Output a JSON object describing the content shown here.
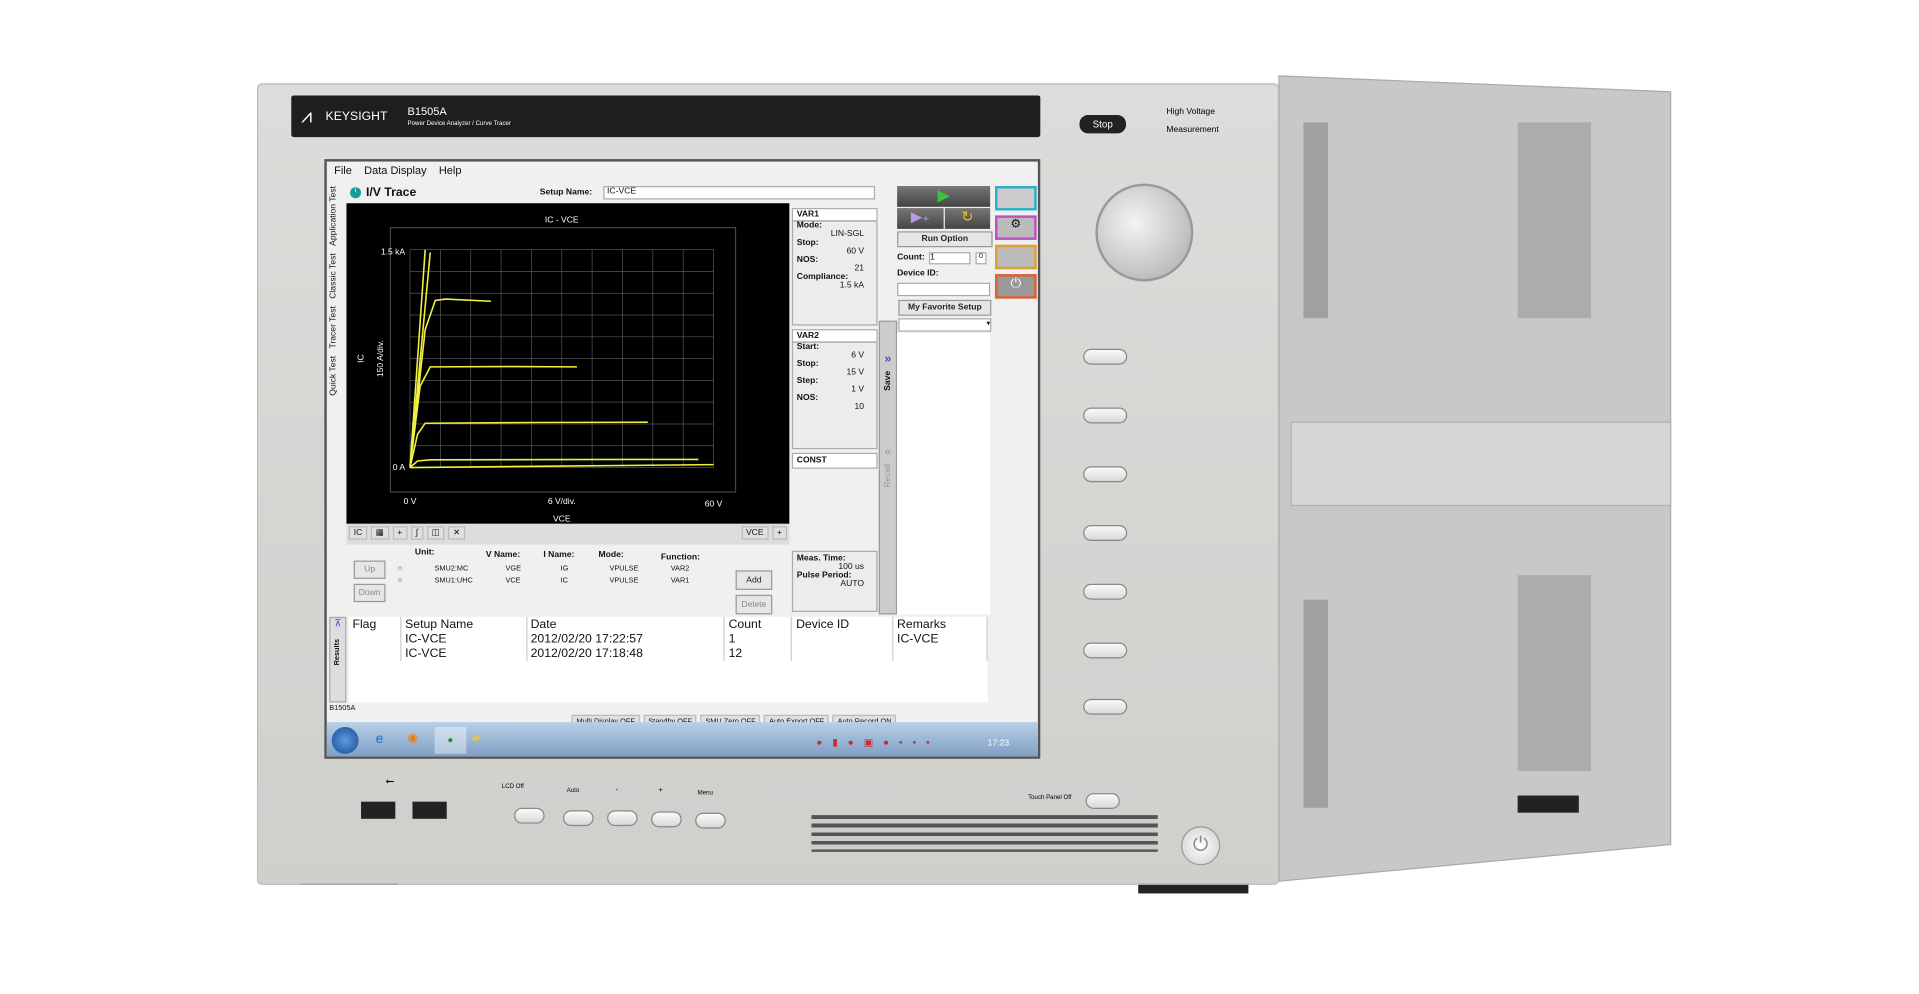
{
  "instrument": {
    "brand": "KEYSIGHT",
    "model": "B1505A",
    "subtitle": "Power Device Analyzer / Curve Tracer",
    "stop_label": "Stop",
    "indicators": [
      "High Voltage",
      "Measurement"
    ],
    "front_buttons": [
      "LCD Off",
      "Auto",
      "-",
      "+",
      "Menu"
    ],
    "touch_panel_label": "Touch Panel Off"
  },
  "menu": [
    "File",
    "Data Display",
    "Help"
  ],
  "side_tabs": [
    "Application Test",
    "Classic Test",
    "Tracer Test",
    "Quick Test"
  ],
  "title": "I/V Trace",
  "setup_name_label": "Setup Name:",
  "setup_name_value": "IC-VCE",
  "plot": {
    "title": "IC - VCE",
    "ylabel": "IC",
    "ydiv": "150 A/div.",
    "ytop": "1.5 kA",
    "ybottom": "0 A",
    "xleft": "0 V",
    "xdiv": "6 V/div.",
    "xright": "60 V",
    "xlabel": "VCE",
    "y_select": "IC",
    "x_select": "VCE"
  },
  "chart_data": {
    "type": "line",
    "title": "IC - VCE",
    "xlabel": "VCE",
    "ylabel": "IC",
    "xlim": [
      0,
      60
    ],
    "ylim": [
      0,
      1500
    ],
    "x_unit": "V",
    "y_unit": "A",
    "grid": true,
    "trace_color": "#f0f040",
    "series": [
      {
        "points": [
          [
            0,
            0
          ],
          [
            30,
            10
          ],
          [
            60,
            20
          ]
        ]
      },
      {
        "points": [
          [
            0,
            0
          ],
          [
            1.5,
            45
          ],
          [
            4,
            53
          ],
          [
            30,
            55
          ],
          [
            57,
            56
          ]
        ]
      },
      {
        "points": [
          [
            0,
            0
          ],
          [
            1.5,
            230
          ],
          [
            3,
            305
          ],
          [
            25,
            310
          ],
          [
            47,
            312
          ]
        ]
      },
      {
        "points": [
          [
            0,
            0
          ],
          [
            2,
            560
          ],
          [
            4,
            693
          ],
          [
            20,
            695
          ],
          [
            33,
            693
          ]
        ]
      },
      {
        "points": [
          [
            0,
            0
          ],
          [
            3,
            950
          ],
          [
            5,
            1150
          ],
          [
            7,
            1160
          ],
          [
            16,
            1145
          ]
        ]
      },
      {
        "points": [
          [
            0,
            0
          ],
          [
            3,
            1500
          ]
        ]
      },
      {
        "points": [
          [
            0,
            0
          ],
          [
            4,
            1480
          ]
        ]
      }
    ]
  },
  "var1": {
    "header": "VAR1",
    "mode_label": "Mode:",
    "mode": "LIN-SGL",
    "stop_label": "Stop:",
    "stop": "60 V",
    "nos_label": "NOS:",
    "nos": "21",
    "compliance_label": "Compliance:",
    "compliance": "1.5 kA"
  },
  "var2": {
    "header": "VAR2",
    "start_label": "Start:",
    "start": "6 V",
    "stop_label": "Stop:",
    "stop": "15 V",
    "step_label": "Step:",
    "step": "1 V",
    "nos_label": "NOS:",
    "nos": "10"
  },
  "const": {
    "header": "CONST"
  },
  "timing": {
    "meas_label": "Meas. Time:",
    "meas": "100 us",
    "period_label": "Pulse Period:",
    "period": "AUTO"
  },
  "side_strip": {
    "save": "Save",
    "recall": "Recall"
  },
  "run": {
    "run_option": "Run Option",
    "count_label": "Count:",
    "count": "1",
    "count_badge": "0",
    "device_id_label": "Device ID:",
    "favorite": "My Favorite Setup"
  },
  "channels": {
    "headers": {
      "unit": "Unit:",
      "vname": "V Name:",
      "iname": "I Name:",
      "mode": "Mode:",
      "function": "Function:"
    },
    "rows": [
      {
        "unit": "SMU2:MC",
        "vname": "VGE",
        "iname": "IG",
        "mode": "VPULSE",
        "function": "VAR2"
      },
      {
        "unit": "SMU1:UHC",
        "vname": "VCE",
        "iname": "IC",
        "mode": "VPULSE",
        "function": "VAR1"
      }
    ],
    "up": "Up",
    "down": "Down",
    "add": "Add",
    "delete": "Delete"
  },
  "results": {
    "tab": "Results",
    "columns": [
      "Flag",
      "Setup Name",
      "Date",
      "Count",
      "Device ID",
      "Remarks"
    ],
    "rows": [
      [
        "",
        "IC-VCE",
        "2012/02/20 17:22:57",
        "1",
        "",
        "IC-VCE"
      ],
      [
        "",
        "IC-VCE",
        "2012/02/20 17:18:48",
        "12",
        "",
        ""
      ]
    ]
  },
  "status": {
    "app": "B1505A",
    "items": [
      "Multi Display OFF",
      "Standby OFF",
      "SMU Zero OFF",
      "Auto Export OFF",
      "Auto Record ON"
    ]
  },
  "taskbar": {
    "clock": "17:23"
  },
  "colors": {
    "trace": "#f0f040",
    "plot_bg": "#000000",
    "var_arrow": "#6a3cc8",
    "run_green": "#40c040"
  }
}
